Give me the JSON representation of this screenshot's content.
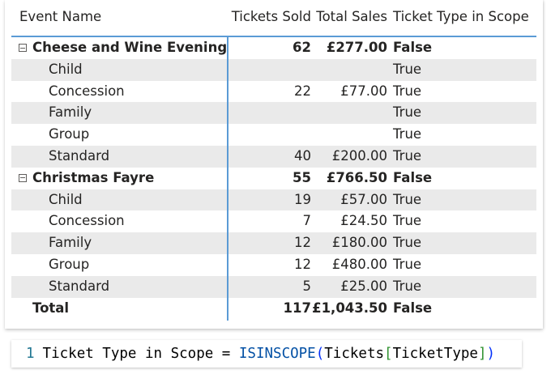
{
  "headers": {
    "event_name": "Event Name",
    "tickets_sold": "Tickets Sold",
    "total_sales": "Total Sales",
    "in_scope": "Ticket Type in Scope"
  },
  "rows": [
    {
      "name": "Cheese and Wine Evening",
      "tickets": "62",
      "sales": "£277.00",
      "scope": "False"
    },
    {
      "name": "Child",
      "tickets": "",
      "sales": "",
      "scope": "True"
    },
    {
      "name": "Concession",
      "tickets": "22",
      "sales": "£77.00",
      "scope": "True"
    },
    {
      "name": "Family",
      "tickets": "",
      "sales": "",
      "scope": "True"
    },
    {
      "name": "Group",
      "tickets": "",
      "sales": "",
      "scope": "True"
    },
    {
      "name": "Standard",
      "tickets": "40",
      "sales": "£200.00",
      "scope": "True"
    },
    {
      "name": "Christmas Fayre",
      "tickets": "55",
      "sales": "£766.50",
      "scope": "False"
    },
    {
      "name": "Child",
      "tickets": "19",
      "sales": "£57.00",
      "scope": "True"
    },
    {
      "name": "Concession",
      "tickets": "7",
      "sales": "£24.50",
      "scope": "True"
    },
    {
      "name": "Family",
      "tickets": "12",
      "sales": "£180.00",
      "scope": "True"
    },
    {
      "name": "Group",
      "tickets": "12",
      "sales": "£480.00",
      "scope": "True"
    },
    {
      "name": "Standard",
      "tickets": "5",
      "sales": "£25.00",
      "scope": "True"
    }
  ],
  "total": {
    "name": "Total",
    "tickets": "117",
    "sales": "£1,043.50",
    "scope": "False"
  },
  "formula": {
    "line_number": "1",
    "measure": "Ticket Type in Scope =",
    "function": "ISINSCOPE",
    "open_paren": "(",
    "table": "Tickets",
    "open_bracket": "[",
    "column": "TicketType",
    "close_bracket": "]",
    "close_paren": ")"
  },
  "colors": {
    "accent_line": "#5b9bd5",
    "alt_row": "#eaeaea",
    "function_blue": "#0451a5"
  }
}
